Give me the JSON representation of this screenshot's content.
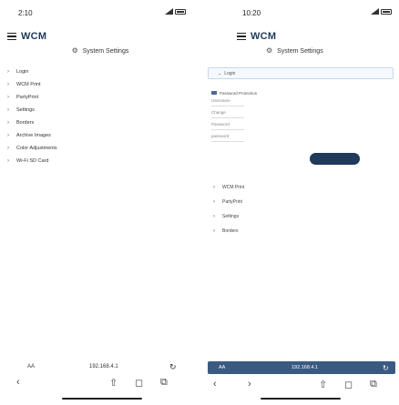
{
  "left": {
    "status": {
      "time": "2:10"
    },
    "app_title": "WCM",
    "settings_title": "System Settings",
    "tree": [
      "Login",
      "WCM Print",
      "PartyPrint",
      "Settings",
      "Borders",
      "Archive Images",
      "Color Adjustments",
      "Wi-Fi SD Card"
    ],
    "bottom": {
      "aa": "AA",
      "ip": "192.168.4.1"
    }
  },
  "right": {
    "status": {
      "time": "10:20"
    },
    "app_title": "WCM",
    "settings_title": "System Settings",
    "accordion_label": "Login",
    "form": {
      "checkbox_label": "Password Protection",
      "field1": "Username",
      "field2": "Change",
      "field3": "Password",
      "field4": "password"
    },
    "tree": [
      "WCM Print",
      "PartyPrint",
      "Settings",
      "Borders"
    ],
    "bottom": {
      "aa": "AA",
      "ip": "192.168.4.1"
    }
  },
  "icons": {
    "gear": "⚙",
    "chevron": "›",
    "down": "⌄",
    "reload": "↻",
    "back": "‹",
    "forward": "›",
    "share": "⇧",
    "book": "◻",
    "tabs": "⧉"
  }
}
